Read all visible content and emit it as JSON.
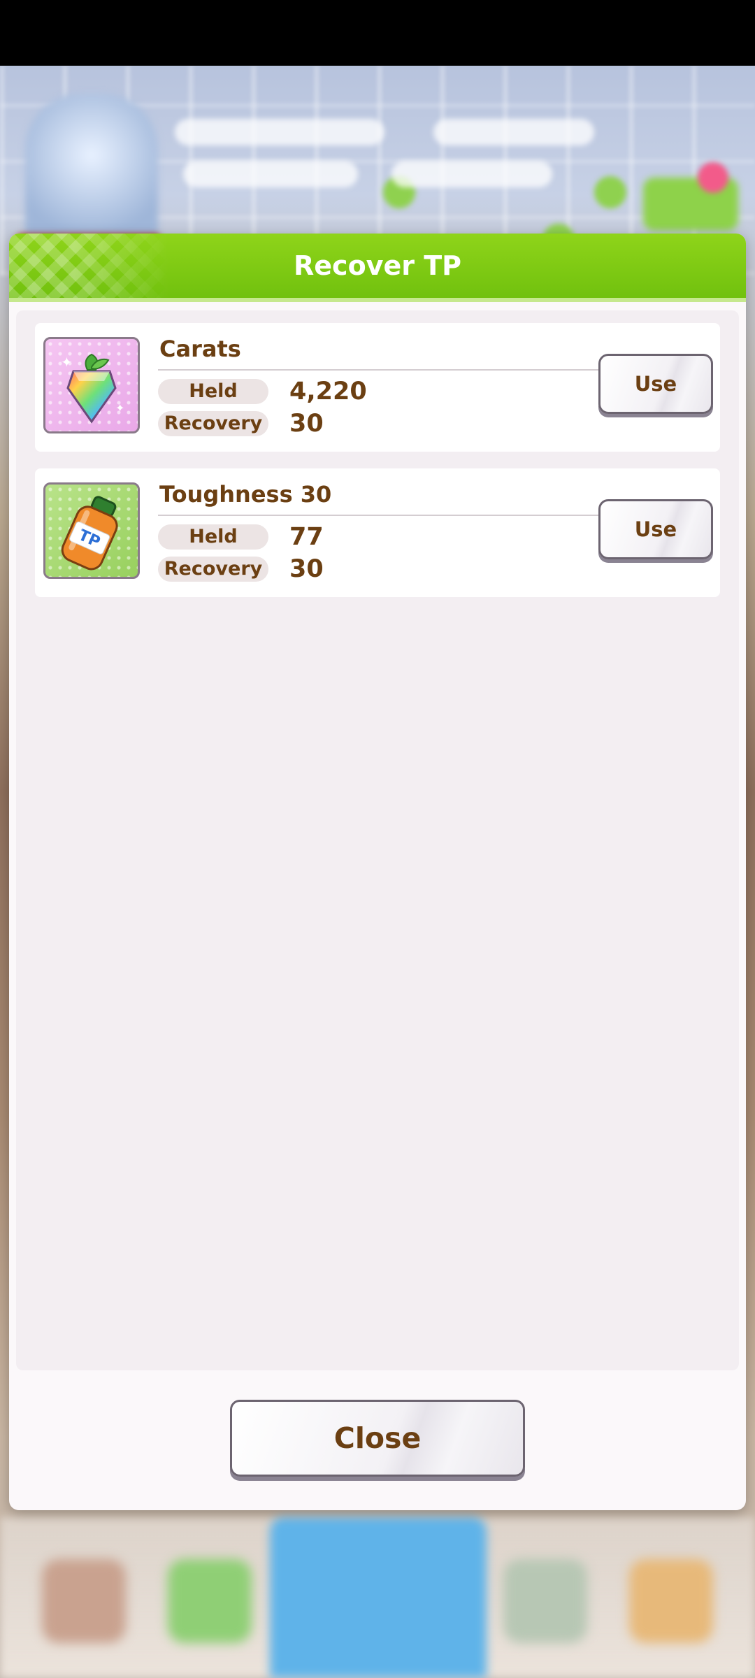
{
  "dialog": {
    "title": "Recover TP",
    "close_label": "Close"
  },
  "items": [
    {
      "name": "Carats",
      "held_label": "Held",
      "held_value": "4,220",
      "recovery_label": "Recovery",
      "recovery_value": "30",
      "use_label": "Use",
      "icon": "carat-crystal-icon"
    },
    {
      "name": "Toughness 30",
      "held_label": "Held",
      "held_value": "77",
      "recovery_label": "Recovery",
      "recovery_value": "30",
      "use_label": "Use",
      "icon": "tp-bottle-icon"
    }
  ],
  "colors": {
    "header_green": "#7fcb14",
    "text_brown": "#6b3f12",
    "panel_bg": "#f3eef2"
  }
}
